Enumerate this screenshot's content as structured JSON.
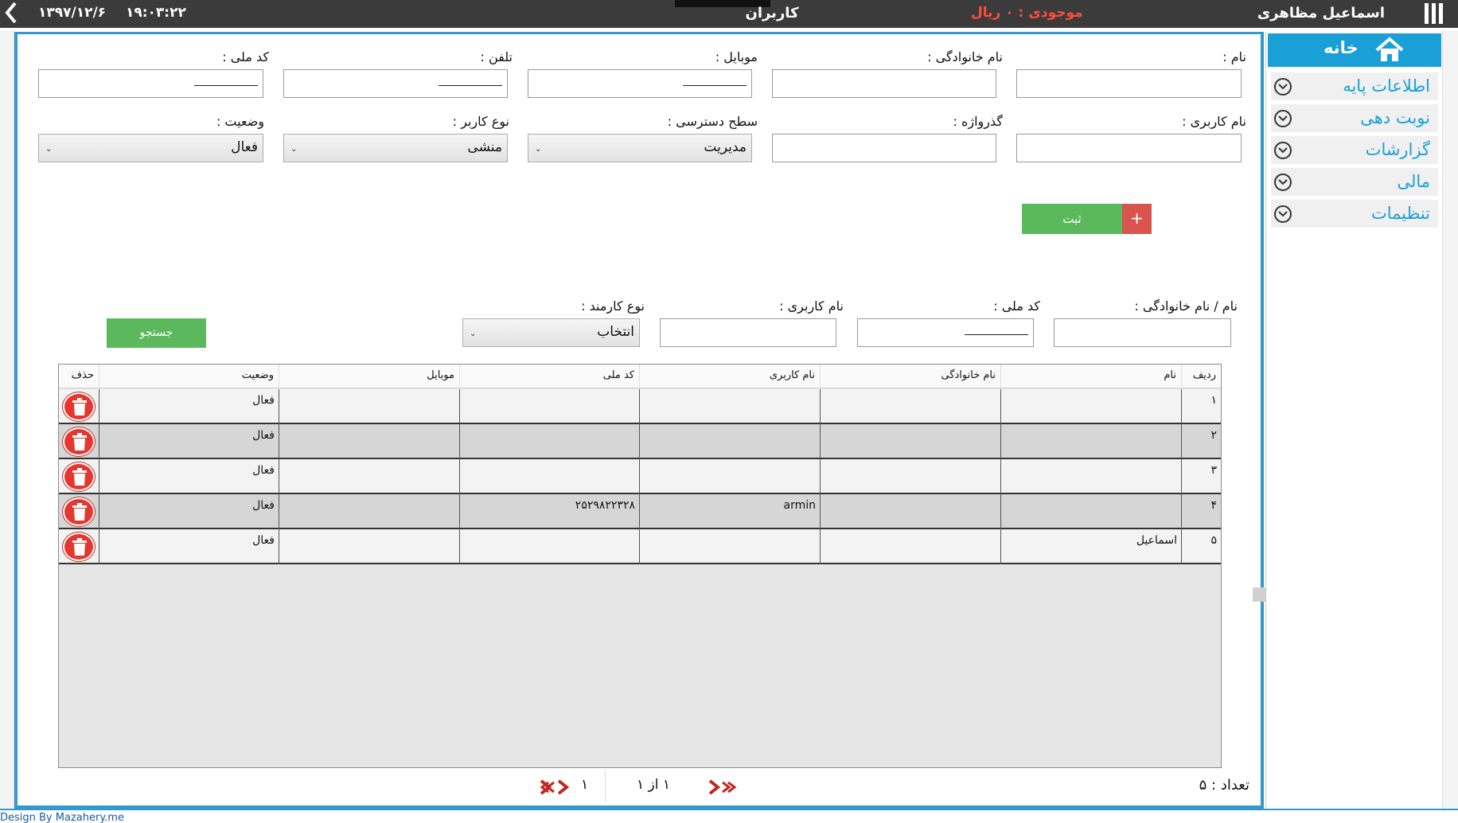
{
  "topbar": {
    "date": "۱۳۹۷/۱۲/۶",
    "time": "۱۹:۰۳:۲۲",
    "title": "کاربران",
    "balance": "موجودی : ۰ ریال",
    "username": "اسماعیل مظاهری"
  },
  "sidebar": {
    "home": "خانه",
    "items": [
      {
        "label": "اطلاعات پایه"
      },
      {
        "label": "نوبت دهی"
      },
      {
        "label": "گزارشات"
      },
      {
        "label": "مالی"
      },
      {
        "label": "تنظیمات"
      }
    ]
  },
  "form": {
    "first_name_label": "نام :",
    "last_name_label": "نام خانوادگی :",
    "mobile_label": "موبایل :",
    "phone_label": "تلفن :",
    "national_code_label": "کد ملی :",
    "username_label": "نام کاربری :",
    "password_label": "گذرواژه :",
    "access_level_label": "سطح دسترسی :",
    "access_level_value": "مدیریت",
    "user_type_label": "نوع کاربر :",
    "user_type_value": "منشی",
    "status_label": "وضعیت :",
    "status_value": "فعال",
    "submit_label": "ثبت",
    "submit_plus": "+"
  },
  "search": {
    "name_label": "نام / نام خانوادگی :",
    "national_code_label": "کد ملی :",
    "username_label": "نام کاربری :",
    "employee_type_label": "نوع کارمند :",
    "employee_type_value": "انتخاب",
    "search_button": "جستجو"
  },
  "table": {
    "headers": {
      "row": "ردیف",
      "name": "نام",
      "family": "نام خانوادگی",
      "username": "نام کاربری",
      "national_code": "کد ملی",
      "mobile": "موبایل",
      "status": "وضعیت",
      "delete": "حذف"
    },
    "rows": [
      {
        "num": "۱",
        "name": "",
        "family": "",
        "username": "",
        "national_code": "",
        "mobile": "",
        "status": "فعال"
      },
      {
        "num": "۲",
        "name": "",
        "family": "",
        "username": "",
        "national_code": "",
        "mobile": "",
        "status": "فعال"
      },
      {
        "num": "۳",
        "name": "",
        "family": "",
        "username": "",
        "national_code": "",
        "mobile": "",
        "status": "فعال"
      },
      {
        "num": "۴",
        "name": "",
        "family": "",
        "username": "armin",
        "national_code": "۲۵۲۹۸۲۲۳۲۸",
        "mobile": "",
        "status": "فعال"
      },
      {
        "num": "۵",
        "name": "اسماعیل",
        "family": "",
        "username": "",
        "national_code": "",
        "mobile": "",
        "status": "فعال"
      }
    ]
  },
  "pager": {
    "count": "تعداد : ۵",
    "info": "۱ از ۱",
    "page": "۱"
  },
  "footer": {
    "credit": "Design By Mazahery.me"
  },
  "colors": {
    "accent": "#1a9fd6",
    "success": "#5cb85c",
    "danger": "#d9534f",
    "balance": "#ff4c3b"
  }
}
